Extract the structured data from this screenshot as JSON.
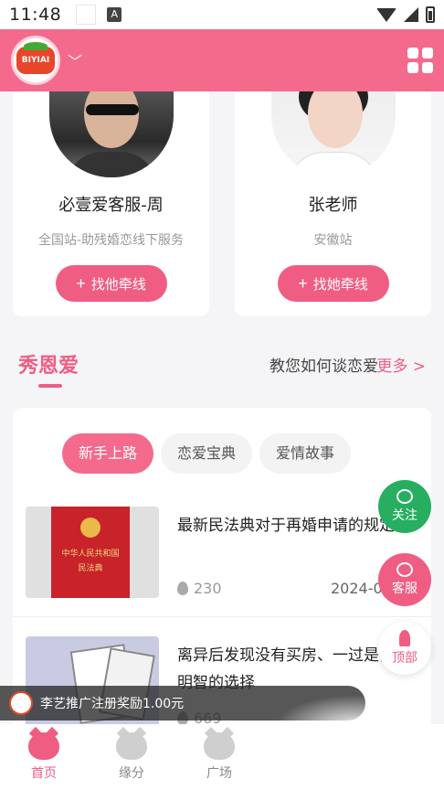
{
  "status_bar": {
    "time": "11:48",
    "a_badge": "A"
  },
  "header": {
    "logo_text": "BIYIAI"
  },
  "counselors": [
    {
      "name": "必壹爱客服-周",
      "desc": "全国站-助残婚恋线下服务",
      "button": "找他牵线"
    },
    {
      "name": "张老师",
      "desc": "安徽站",
      "button": "找她牵线"
    }
  ],
  "section": {
    "title": "秀恩爱",
    "subtitle": "教您如何谈恋爱",
    "more": "更多 >"
  },
  "tabs": [
    "新手上路",
    "恋爱宝典",
    "爱情故事"
  ],
  "articles": [
    {
      "title": "最新民法典对于再婚申请的规定",
      "views": "230",
      "date": "2024-0",
      "cover_line1": "中华人民共和国",
      "cover_line2": "民法典"
    },
    {
      "title": "离异后发现没有买房、一过是我明智的选择",
      "views": "669"
    }
  ],
  "fabs": {
    "follow": "关注",
    "service": "客服",
    "top": "顶部"
  },
  "toast": {
    "text": "李艺推广注册奖励1.00元"
  },
  "bottom_nav": [
    {
      "label": "首页"
    },
    {
      "label": "缘分"
    },
    {
      "label": "广场"
    }
  ],
  "colors": {
    "brand_pink": "#f05d83",
    "header_pink": "#f46a8c",
    "follow_green": "#27ae60"
  }
}
